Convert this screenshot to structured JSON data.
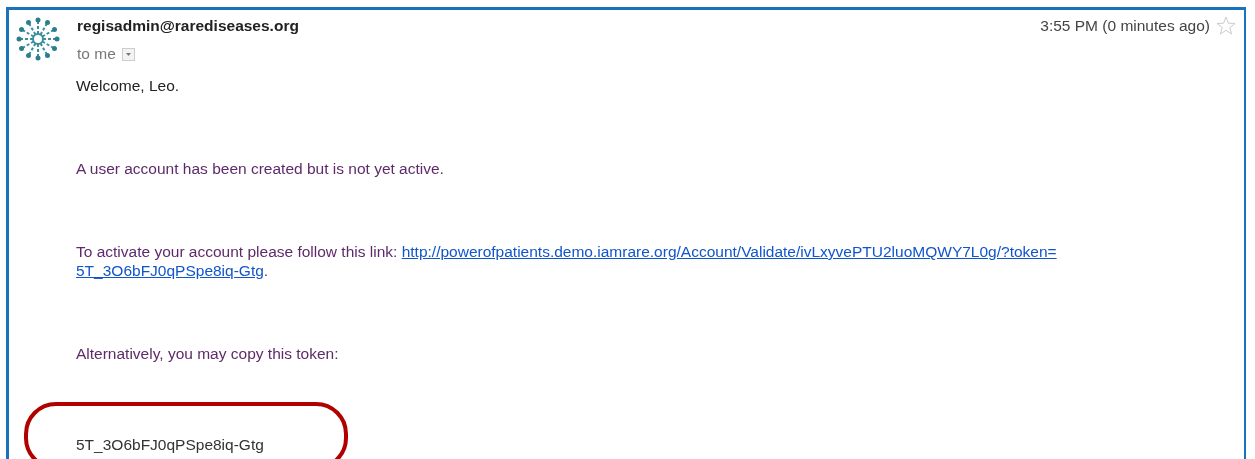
{
  "message": {
    "sender": "regisadmin@rarediseases.org",
    "recipient": "to me",
    "time": "3:55 PM (0 minutes ago)",
    "starred": false,
    "body": [
      {
        "kind": "plain",
        "text": "Welcome, Leo."
      },
      {
        "kind": "notice",
        "text": "A user account has been created but is not yet active."
      },
      {
        "kind": "link",
        "text": "To activate your account please follow this link: ",
        "link_lines": [
          "http://powerofpatients.demo.iamrare.org/Account/Validate/ivLxyvePTU2luoMQWY7L0g/?token=",
          "5T_3O6bFJ0qPSpe8iq-Gtg"
        ],
        "after": "."
      },
      {
        "kind": "notice",
        "text": "Alternatively, you may copy this token:"
      },
      {
        "kind": "token",
        "text": "5T_3O6bFJ0qPSpe8iq-Gtg",
        "circled": true
      }
    ]
  }
}
